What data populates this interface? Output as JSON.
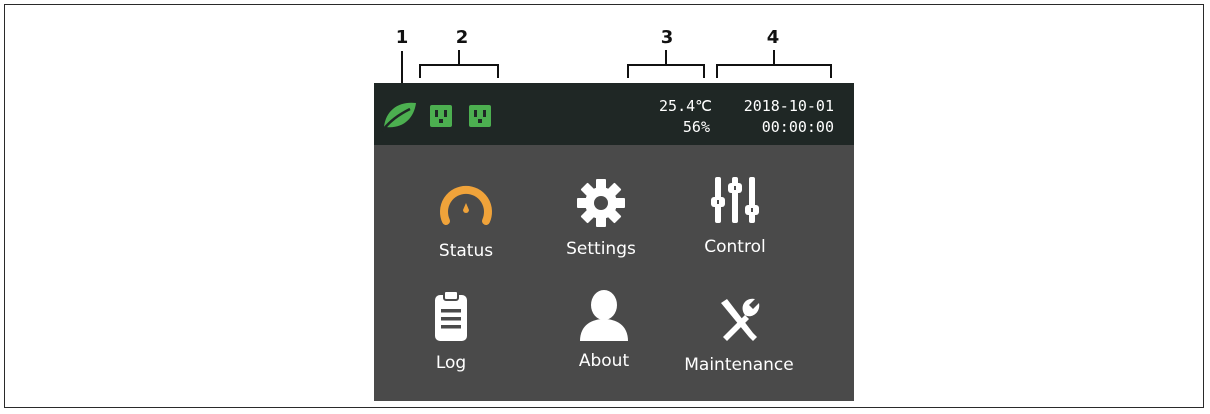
{
  "callouts": [
    "1",
    "2",
    "3",
    "4"
  ],
  "status_bar": {
    "temperature": "25.4℃",
    "humidity": "56%",
    "date": "2018-10-01",
    "time": "00:00:00",
    "icons": [
      "leaf-icon",
      "outlet-icon",
      "outlet-icon"
    ]
  },
  "menu": [
    {
      "label": "Status",
      "icon": "gauge-icon",
      "color": "#f0a33a"
    },
    {
      "label": "Settings",
      "icon": "gear-icon",
      "color": "#ffffff"
    },
    {
      "label": "Control",
      "icon": "sliders-icon",
      "color": "#ffffff"
    },
    {
      "label": "Log",
      "icon": "clipboard-icon",
      "color": "#ffffff"
    },
    {
      "label": "About",
      "icon": "user-icon",
      "color": "#ffffff"
    },
    {
      "label": "Maintenance",
      "icon": "tools-icon",
      "color": "#ffffff"
    }
  ],
  "colors": {
    "screen_bg": "#4a4a4a",
    "status_bg": "#1f2725",
    "accent_green": "#4caf50",
    "accent_orange": "#f0a33a"
  }
}
